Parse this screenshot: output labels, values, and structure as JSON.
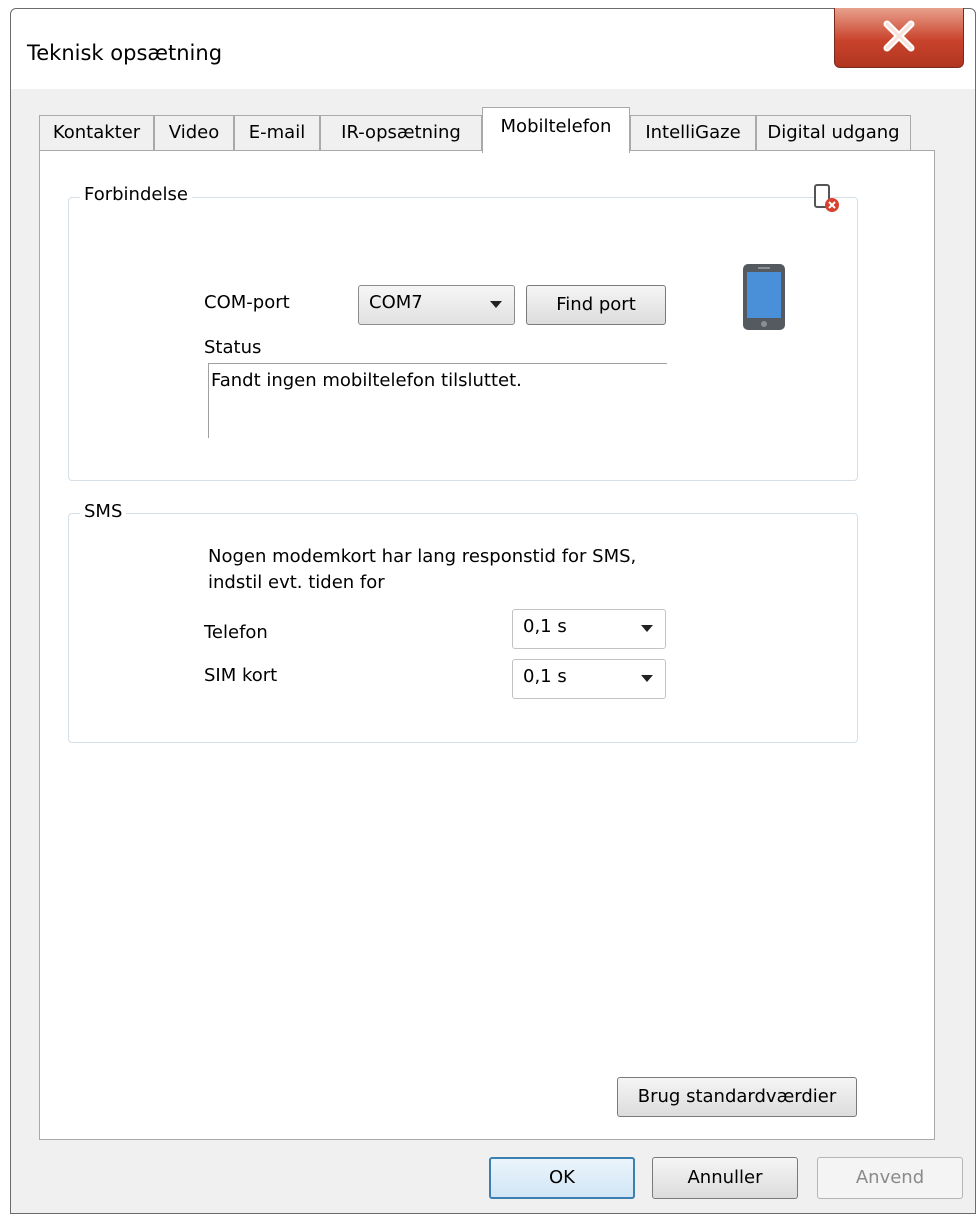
{
  "window": {
    "title": "Teknisk opsætning"
  },
  "tabs": [
    {
      "label": "Kontakter"
    },
    {
      "label": "Video"
    },
    {
      "label": "E-mail"
    },
    {
      "label": "IR-opsætning"
    },
    {
      "label": "Mobiltelefon",
      "active": true
    },
    {
      "label": "IntelliGaze"
    },
    {
      "label": "Digital udgang"
    }
  ],
  "connection": {
    "legend": "Forbindelse",
    "com_port_label": "COM-port",
    "com_port_value": "COM7",
    "find_port_label": "Find port",
    "status_label": "Status",
    "status_text": "Fandt ingen mobiltelefon tilsluttet.",
    "phone_icon": "mobile-phone-icon",
    "disconnected_icon": "phone-disconnected-icon"
  },
  "sms": {
    "legend": "SMS",
    "info_line1": "Nogen modemkort har lang responstid for SMS,",
    "info_line2": "indstil evt. tiden for",
    "phone_label": "Telefon",
    "phone_value": "0,1 s",
    "sim_label": "SIM kort",
    "sim_value": "0,1 s"
  },
  "defaults_button": "Brug standardværdier",
  "footer": {
    "ok": "OK",
    "cancel": "Annuller",
    "apply": "Anvend"
  },
  "colors": {
    "close_button": "#c9432c",
    "phone_screen": "#4a90d9",
    "error_badge": "#d9412e"
  }
}
